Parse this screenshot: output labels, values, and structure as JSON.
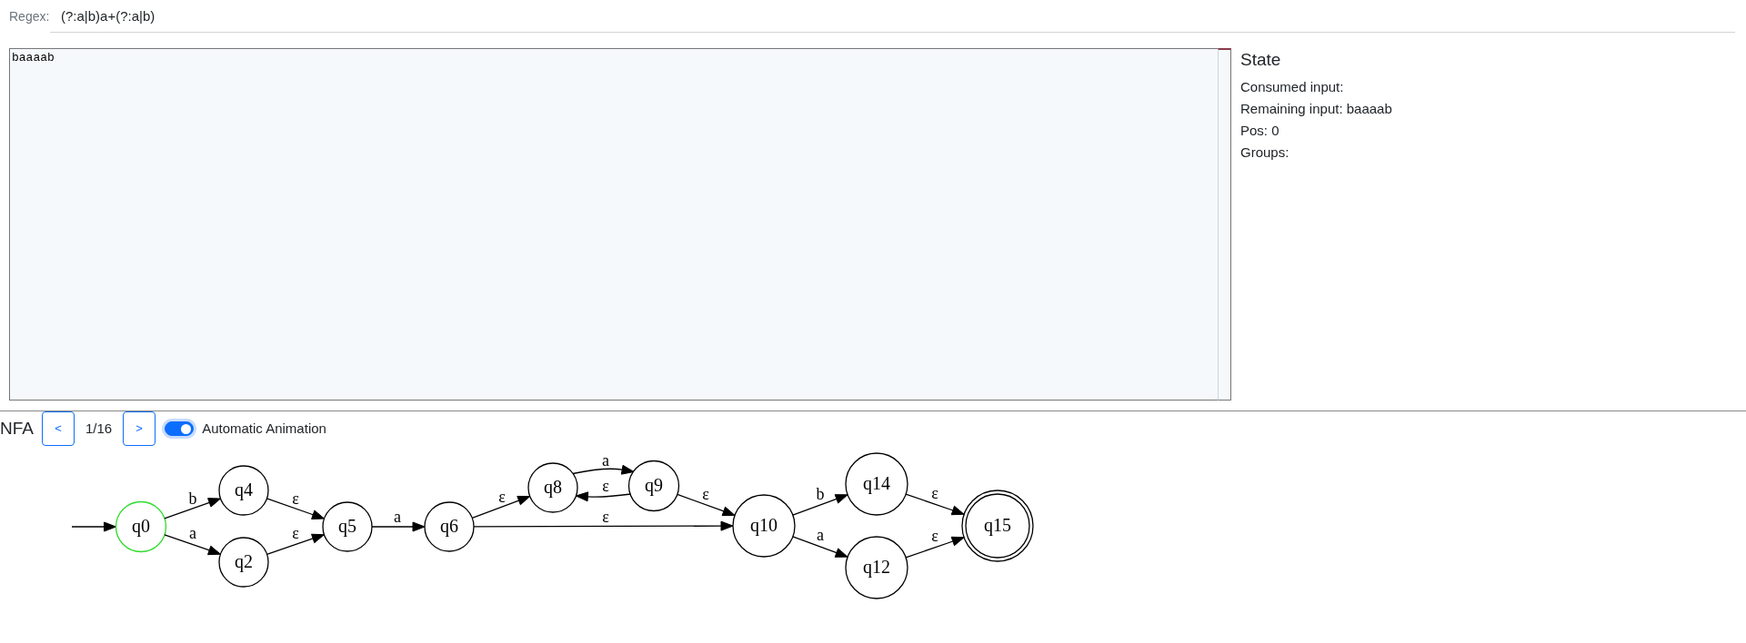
{
  "regex": {
    "label": "Regex:",
    "value": "(?:a|b)a+(?:a|b)"
  },
  "test_input": {
    "value": "baaaab"
  },
  "state_panel": {
    "title": "State",
    "lines": [
      "Consumed input:",
      "Remaining input: baaaab",
      "Pos: 0",
      "Groups:"
    ]
  },
  "nfa": {
    "title": "NFA",
    "prev_button": "<",
    "step": "1/16",
    "next_button": ">",
    "auto_animation": {
      "label": "Automatic Animation",
      "on": true
    },
    "states": [
      {
        "label": "q0",
        "initial": true,
        "current": true,
        "accepting": false
      },
      {
        "label": "q4",
        "initial": false,
        "current": false,
        "accepting": false
      },
      {
        "label": "q2",
        "initial": false,
        "current": false,
        "accepting": false
      },
      {
        "label": "q5",
        "initial": false,
        "current": false,
        "accepting": false
      },
      {
        "label": "q6",
        "initial": false,
        "current": false,
        "accepting": false
      },
      {
        "label": "q8",
        "initial": false,
        "current": false,
        "accepting": false
      },
      {
        "label": "q9",
        "initial": false,
        "current": false,
        "accepting": false
      },
      {
        "label": "q10",
        "initial": false,
        "current": false,
        "accepting": false
      },
      {
        "label": "q14",
        "initial": false,
        "current": false,
        "accepting": false
      },
      {
        "label": "q12",
        "initial": false,
        "current": false,
        "accepting": false
      },
      {
        "label": "q15",
        "initial": false,
        "current": false,
        "accepting": true
      }
    ],
    "transitions": [
      {
        "label": "b"
      },
      {
        "label": "a"
      },
      {
        "label": "ε"
      },
      {
        "label": "ε"
      },
      {
        "label": "a"
      },
      {
        "label": "ε"
      },
      {
        "label": "a"
      },
      {
        "label": "ε"
      },
      {
        "label": "ε"
      },
      {
        "label": "ε"
      },
      {
        "label": "b"
      },
      {
        "label": "a"
      },
      {
        "label": "ε"
      },
      {
        "label": "ε"
      }
    ]
  }
}
